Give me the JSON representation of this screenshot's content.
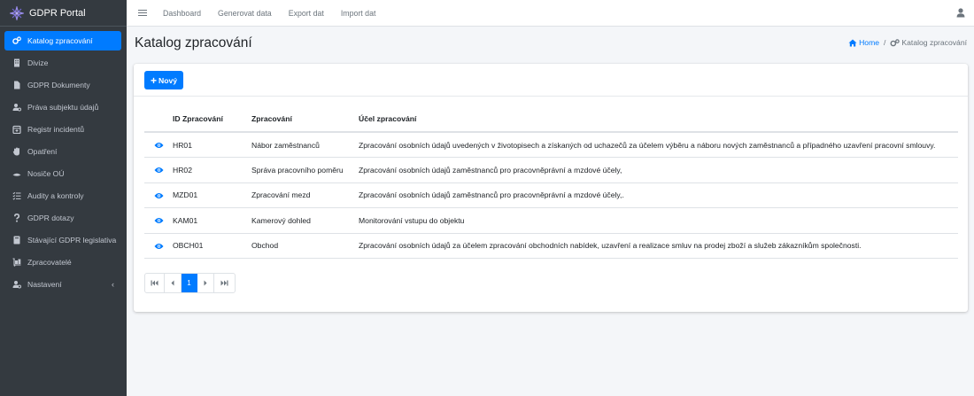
{
  "app": {
    "title": "GDPR Portal"
  },
  "sidebar": {
    "items": [
      {
        "label": "Katalog zpracování",
        "icon": "gears-icon",
        "active": true
      },
      {
        "label": "Divize",
        "icon": "building-icon"
      },
      {
        "label": "GDPR Dokumenty",
        "icon": "file-icon"
      },
      {
        "label": "Práva subjektu údajů",
        "icon": "user-cog-icon"
      },
      {
        "label": "Registr incidentů",
        "icon": "calendar-icon"
      },
      {
        "label": "Opatření",
        "icon": "hand-icon"
      },
      {
        "label": "Nosiče OÚ",
        "icon": "drive-icon"
      },
      {
        "label": "Audity a kontroly",
        "icon": "checklist-icon"
      },
      {
        "label": "GDPR dotazy",
        "icon": "question-icon"
      },
      {
        "label": "Stávající GDPR legislativa",
        "icon": "book-icon"
      },
      {
        "label": "Zpracovatelé",
        "icon": "dolly-icon"
      },
      {
        "label": "Nastavení",
        "icon": "user-gear-icon",
        "has_arrow": true
      }
    ]
  },
  "topbar": {
    "links": [
      "Dashboard",
      "Generovat data",
      "Export dat",
      "Import dat"
    ]
  },
  "page": {
    "title": "Katalog zpracování",
    "breadcrumb_home": "Home",
    "breadcrumb_current": "Katalog zpracování"
  },
  "card": {
    "new_button": "Nový"
  },
  "table": {
    "headers": [
      "ID Zpracování",
      "Zpracování",
      "Účel zpracování"
    ],
    "rows": [
      {
        "id": "HR01",
        "name": "Nábor zaměstnanců",
        "purpose": "Zpracování osobních údajů uvedených v životopisech a získaných od uchazečů za účelem výběru a náboru nových zaměstnanců a případného uzavření pracovní smlouvy."
      },
      {
        "id": "HR02",
        "name": "Správa pracovního poměru",
        "purpose": "Zpracování osobních údajů zaměstnanců pro pracovněprávní a mzdové účely,"
      },
      {
        "id": "MZD01",
        "name": "Zpracování mezd",
        "purpose": "Zpracování osobních údajů zaměstnanců pro pracovněprávní a mzdové účely,."
      },
      {
        "id": "KAM01",
        "name": "Kamerový dohled",
        "purpose": "Monitorování vstupu do objektu"
      },
      {
        "id": "OBCH01",
        "name": "Obchod",
        "purpose": "Zpracování osobních údajů za účelem zpracování obchodních nabídek, uzavření a realizace smluv na prodej zboží a služeb zákazníkům společnosti."
      }
    ]
  },
  "pagination": {
    "current_page": "1"
  },
  "colors": {
    "primary": "#007bff",
    "sidebar_bg": "#343a40",
    "content_bg": "#f4f6f9"
  }
}
